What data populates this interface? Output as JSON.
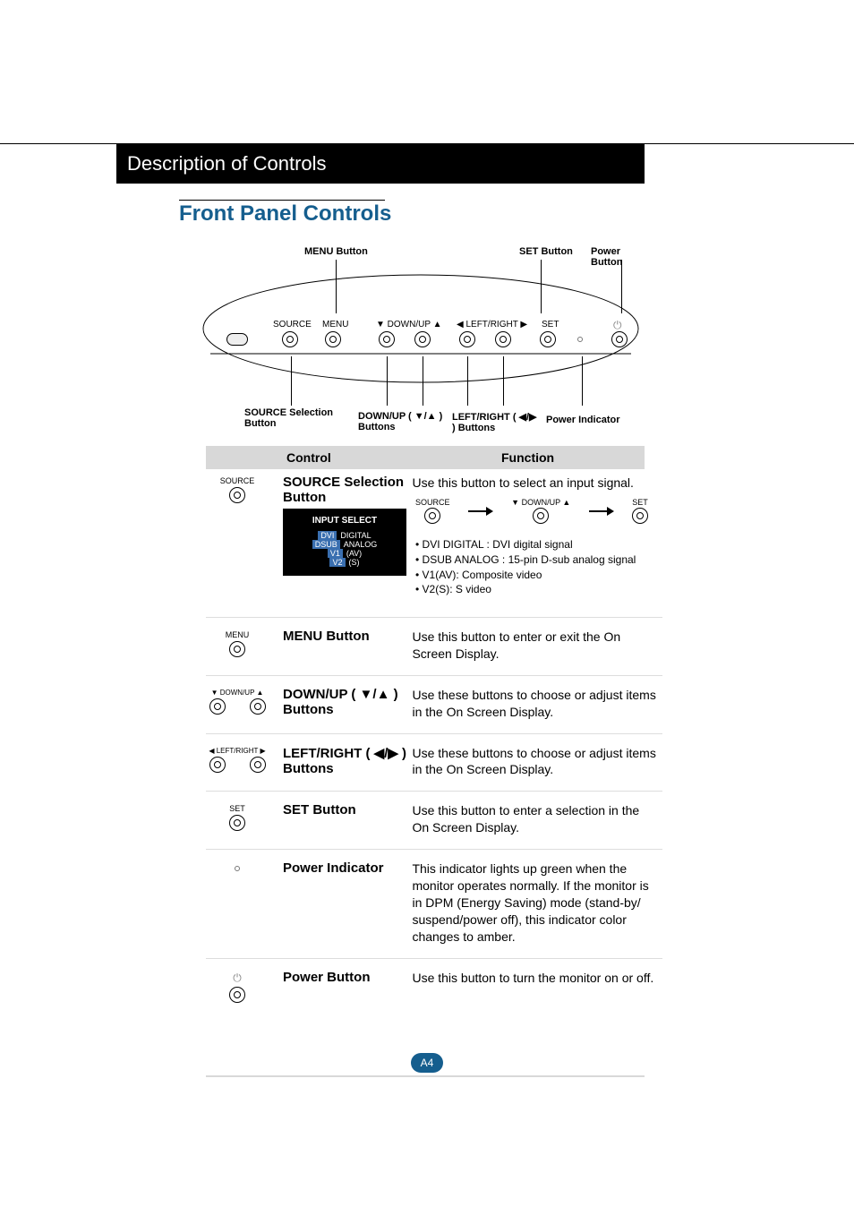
{
  "header": {
    "title": "Description of Controls"
  },
  "subheading": "Front Panel Controls",
  "panel_top_labels": {
    "menu": "MENU Button",
    "set": "SET Button",
    "power": "Power Button"
  },
  "panel_button_text": {
    "source": "SOURCE",
    "menu": "MENU",
    "downup": "▼ DOWN/UP ▲",
    "leftright": "◀ LEFT/RIGHT ▶",
    "set": "SET"
  },
  "panel_bottom_labels": {
    "source": "SOURCE Selection Button",
    "downup": "DOWN/UP  ( ▼/▲ ) Buttons",
    "leftright": "LEFT/RIGHT  ( ◀/▶ ) Buttons",
    "power_indicator": "Power Indicator"
  },
  "table_head": {
    "control": "Control",
    "function": "Function"
  },
  "rows": {
    "source": {
      "icon_text": "SOURCE",
      "label": "SOURCE Selection Button",
      "desc": "Use this button to select an input signal.",
      "input_select": {
        "title": "INPUT SELECT",
        "opts": [
          {
            "c1": "DVI",
            "c2": "DIGITAL"
          },
          {
            "c1": "DSUB",
            "c2": "ANALOG"
          },
          {
            "c1": "V1",
            "c2": "(AV)"
          },
          {
            "c1": "V2",
            "c2": "(S)"
          }
        ]
      },
      "signal_path": {
        "source": "SOURCE",
        "downup": "▼ DOWN/UP ▲",
        "set": "SET"
      },
      "bullets": [
        "DVI DIGITAL : DVI digital signal",
        "DSUB ANALOG : 15-pin D-sub analog signal",
        "V1(AV): Composite video",
        "V2(S): S video"
      ]
    },
    "menu": {
      "icon_text": "MENU",
      "label": "MENU Button",
      "desc": "Use this button to enter or exit the On Screen Display."
    },
    "downup": {
      "icon_text": "▼ DOWN/UP ▲",
      "label": "DOWN/UP ( ▼/▲ ) Buttons",
      "desc": "Use these buttons to choose or adjust items in the On Screen Display."
    },
    "leftright": {
      "icon_text": "◀ LEFT/RIGHT ▶",
      "label": "LEFT/RIGHT ( ◀/▶ ) Buttons",
      "desc": "Use these buttons to choose or adjust items in the On Screen Display."
    },
    "set": {
      "icon_text": "SET",
      "label": "SET Button",
      "desc": "Use this button to enter a selection in the On Screen Display."
    },
    "power_indicator": {
      "label": "Power Indicator",
      "desc": "This indicator lights up green when the monitor operates normally. If the monitor is in DPM (Energy Saving) mode (stand-by/ suspend/power off), this indicator color changes to amber."
    },
    "power_button": {
      "label": "Power Button",
      "desc": "Use this button to turn the monitor on or off."
    }
  },
  "page_num": "A4"
}
